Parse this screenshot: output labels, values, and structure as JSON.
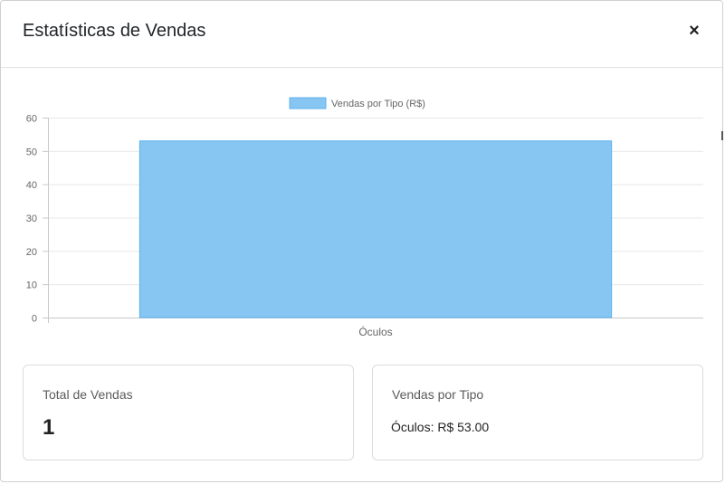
{
  "modal": {
    "title": "Estatísticas de Vendas",
    "close_label": "×"
  },
  "chart_data": {
    "type": "bar",
    "categories": [
      "Óculos"
    ],
    "series": [
      {
        "name": "Vendas por Tipo (R$)",
        "values": [
          53
        ]
      }
    ],
    "ylim": [
      0,
      60
    ],
    "yticks": [
      "0",
      "10",
      "20",
      "30",
      "40",
      "50",
      "60"
    ],
    "grid": true,
    "legend_position": "top-center",
    "colors": {
      "bar_fill": "#87c6f2",
      "bar_stroke": "#5fb1ea",
      "grid": "#e8e8e8",
      "axis": "#c9c9c9",
      "tick_text": "#666666"
    }
  },
  "cards": {
    "total": {
      "title": "Total de Vendas",
      "value": "1"
    },
    "by_type": {
      "title": "Vendas por Tipo",
      "line": "Óculos: R$ 53.00"
    }
  }
}
